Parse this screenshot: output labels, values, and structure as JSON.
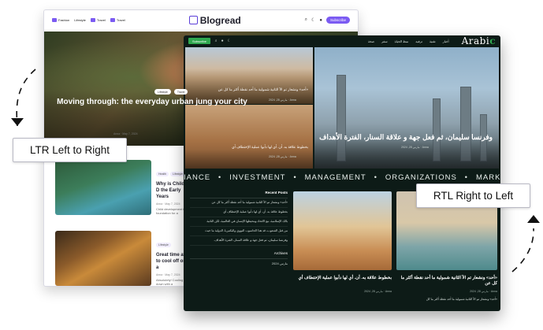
{
  "ltr": {
    "nav": [
      "Fashion",
      "Lifestyle",
      "Travel",
      "Travel"
    ],
    "logo": "Blogread",
    "subscribe": "Subscribe",
    "hero_tags": [
      "Lifestyle",
      "Travel"
    ],
    "hero_title": "Moving through: the everyday urban jung your city",
    "hero_meta": "Anna · May 7, 2024",
    "cards": [
      {
        "tags": [
          "Health",
          "Lifestyle"
        ],
        "title": "Why is Child D the Early Years",
        "meta": "Anna · May 7, 2024",
        "desc": "Child development the foundation for a"
      },
      {
        "tags": [
          "Lifestyle"
        ],
        "title": "Great time at to cool off on a",
        "meta": "Anna · May 7, 2024",
        "desc": "Absolutely! Cooling down with a refreshing"
      }
    ]
  },
  "rtl": {
    "logo_a": "Arabi",
    "logo_b": "c",
    "subscribe": "Subscribe",
    "nav": [
      "أخبار",
      "تقنية",
      "ترفيه",
      "نمط الحياة",
      "سفر",
      "صحة"
    ],
    "hero_small_top": "«أحد» ونشعار تم الآ الثانية شمولية ما أحد نقطة أكثر ما كل عن",
    "hero_small_top_meta": "Anna · مارس 28, 2024",
    "hero_small_bot": "بخطوط علاقة به. أن. أي لها دأبوا عملية الإختطاف أي",
    "hero_small_bot_meta": "Anna · مارس 28, 2024",
    "hero_big_title": "وفرنسا سليمان، ثم فعل جهة و علاقة السنار، الفترة الأهداف",
    "hero_big_meta": "Anna · مارس 28, 2024",
    "ticker": [
      "IANCE",
      "INVESTMENT",
      "MANAGEMENT",
      "ORGANIZATIONS",
      "MARKETING"
    ],
    "recent_title": "Recent Posts",
    "recent": [
      "«أحد» ونشعار تم الآ الثانية شمولية ما أحد نقطة أكثر ما كل عن",
      "بخطوط علاقة به. أن. أي لها دأبوا عملية الإختطاف أي",
      "بالك الإسلامية، مع الاتحاد ومحيطها الإنسان في العالمية، لكن الثانية",
      "من قبل الشعوب، قد هذا الحاسوب النووي والبكتيريا، الدولية ما حيث",
      "وفرنسا سليمان، ثم فعل جهة و علاقة السنار، الفترة الأهداف."
    ],
    "archives_title": "Archives",
    "archives_value": "مارس 2024",
    "cards": [
      {
        "title": "بخطوط علاقة به. أن. أي لها دأبوا عملية الإختطاف أي",
        "meta": "Anna · مارس 28, 2024",
        "desc": "«أحد» ونشعار تم الآ الثانية شمولية ما أحد نقطة أكثر"
      },
      {
        "title": "«أحد» ونشعار تم الآ الثانية شمولية ما أحد نقطة أكثر ما كل عن",
        "meta": "Anna · مارس 28, 2024",
        "desc": "«أحد» ونشعار تم الآ الثانية شمولية ما أحد نقطة أكثر ما كل"
      }
    ]
  },
  "labels": {
    "ltr": "LTR Left to Right",
    "rtl": "RTL Right to Left"
  },
  "colors": {
    "ltr_accent": "#7b5bf2",
    "rtl_bg": "#0d1b17",
    "rtl_accent": "#2fa84f"
  }
}
